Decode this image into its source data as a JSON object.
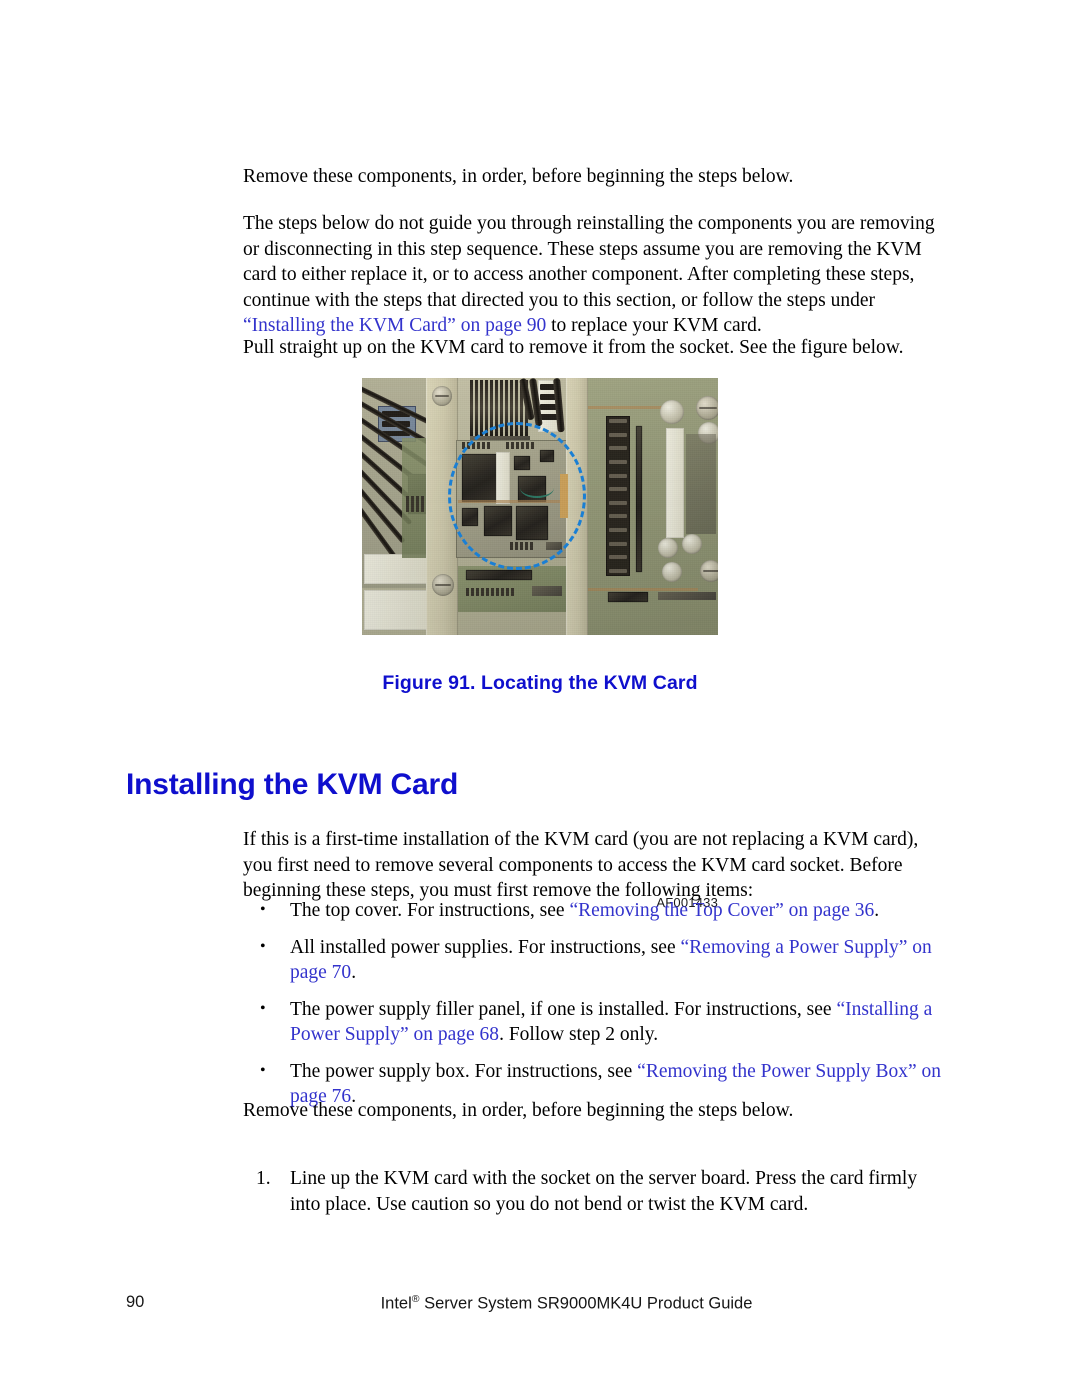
{
  "document": {
    "page_number": "90",
    "footer_guide": "Intel",
    "footer_guide_reg": "®",
    "footer_guide_rest": " Server System SR9000MK4U Product Guide"
  },
  "intro": {
    "para1": "Remove these components, in order, before beginning the steps below.",
    "para2_part1": "The steps below do not guide you through reinstalling the components you are removing or disconnecting in this step sequence. These steps assume you are removing the KVM card to either replace it, or to access another component. After completing these steps, continue with the steps that directed you to this section, or follow the steps under ",
    "para2_link": "“Installing the KVM Card” on page 90",
    "para2_part2": " to replace your KVM card.",
    "para3": "Pull straight up on the KVM card to remove it from the socket. See the figure below."
  },
  "figure": {
    "photo_code": "AF001433",
    "caption": "Figure 91. Locating the KVM Card",
    "caption_color": "#0f0fcd",
    "highlight_color": "#1a7fd4",
    "alt": "Photograph of the server board showing the KVM card location circled with a blue dashed ellipse"
  },
  "section": {
    "title": "Installing the KVM Card",
    "title_color": "#0f0fcd",
    "intro": "If this is a first-time installation of the KVM card (you are not replacing a KVM card), you first need to remove several components to access the KVM card socket. Before beginning these steps, you must first remove the following items:"
  },
  "bullets": [
    {
      "lead": "The top cover. For instructions, see ",
      "link": "“Removing the Top Cover” on page 36",
      "tail": "."
    },
    {
      "lead": "All installed power supplies. For instructions, see ",
      "link": "“Removing a Power Supply” on page 70",
      "tail": "."
    },
    {
      "lead": "The power supply filler panel, if one is installed. For instructions, see ",
      "link": "“Installing a Power Supply” on page 68",
      "tail": ". Follow step 2 only."
    },
    {
      "lead": "The power supply box. For instructions, see ",
      "link": "“Removing the Power Supply Box” on page 76",
      "tail": "."
    }
  ],
  "after_bullets": {
    "para": "Remove these components, in order, before beginning the steps below."
  },
  "steps": [
    {
      "text": "Line up the KVM card with the socket on the server board. Press the card firmly into place. Use caution so you do not bend or twist the KVM card."
    }
  ],
  "colors": {
    "link": "#3333cc",
    "heading": "#0f0fcd",
    "body": "#000000"
  }
}
